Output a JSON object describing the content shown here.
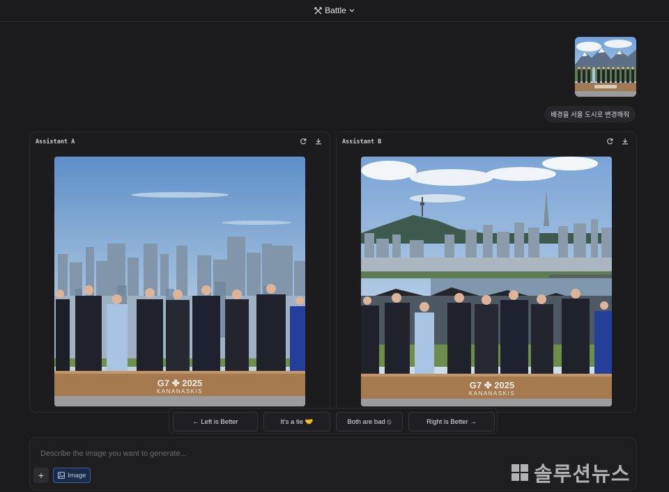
{
  "header": {
    "mode_label": "Battle",
    "mode_icon": "swords-icon"
  },
  "conversation": {
    "user_image_alt": "G7 leaders group photo in front of mountains",
    "user_prompt": "배경을 서울 도시로 변경해줘"
  },
  "panels": [
    {
      "title": "Assistant A",
      "image_alt": "G7 leaders in front of a city skyline",
      "stage_text_1": "G7 ✤ 2025",
      "stage_text_2": "KANANASKIS",
      "icons": [
        "refresh-icon",
        "download-icon"
      ]
    },
    {
      "title": "Assistant B",
      "image_alt": "G7 leaders in front of Seoul skyline with Namsan Tower",
      "stage_text_1": "G7 ✤ 2025",
      "stage_text_2": "KANANASKIS",
      "icons": [
        "refresh-icon",
        "download-icon"
      ]
    }
  ],
  "vote": {
    "left": "← Left is Better",
    "tie": "It's a tie 🤝",
    "bad": "Both are bad ⦸",
    "right": "Right is Better →"
  },
  "composer": {
    "placeholder": "Describe the image you want to generate...",
    "value": "",
    "plus_label": "+",
    "image_toggle_label": "Image"
  },
  "watermark": {
    "text": "솔루션뉴스"
  },
  "colors": {
    "background": "#1b1b1d",
    "panel_border": "#2b2b30",
    "accent": "#3e5fa8"
  }
}
